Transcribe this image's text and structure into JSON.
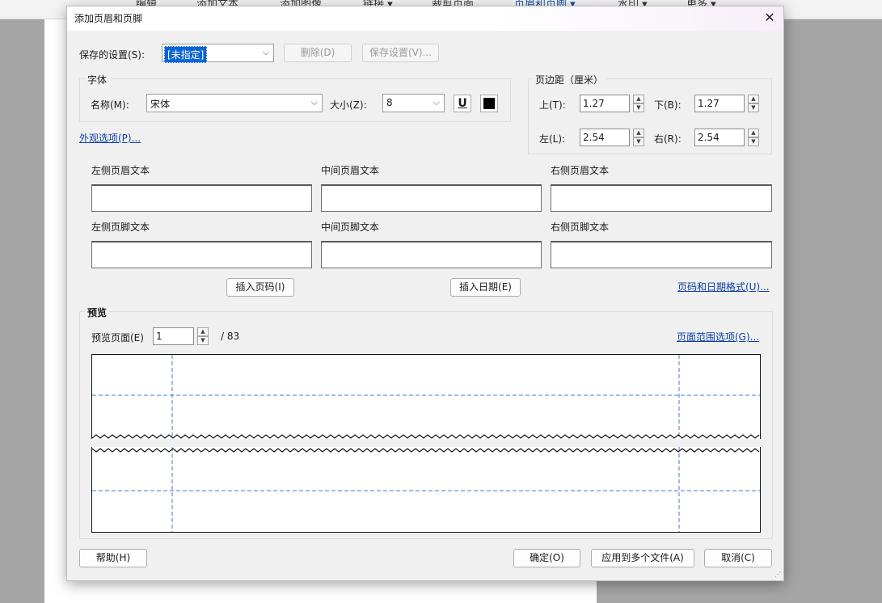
{
  "background_toolbar": {
    "items": [
      "编辑",
      "添加文本",
      "添加图像",
      "链接 ▾",
      "裁剪页面",
      "页眉和页脚 ▾",
      "水印 ▾",
      "更多 ▾"
    ]
  },
  "dialog": {
    "title": "添加页眉和页脚",
    "saved_settings": {
      "label": "保存的设置(S):",
      "value": "[未指定]",
      "delete_label": "删除(D)",
      "save_label": "保存设置(V)..."
    },
    "font": {
      "group_label": "字体",
      "name_label": "名称(M):",
      "name_value": "宋体",
      "size_label": "大小(Z):",
      "size_value": "8",
      "underline_glyph": "U"
    },
    "appearance_link": "外观选项(P)...",
    "margins": {
      "group_label": "页边距（厘米）",
      "top_label": "上(T):",
      "top_value": "1.27",
      "bottom_label": "下(B):",
      "bottom_value": "1.27",
      "left_label": "左(L):",
      "left_value": "2.54",
      "right_label": "右(R):",
      "right_value": "2.54"
    },
    "header_labels": {
      "left": "左侧页眉文本",
      "center": "中间页眉文本",
      "right": "右侧页眉文本"
    },
    "footer_labels": {
      "left": "左侧页脚文本",
      "center": "中间页脚文本",
      "right": "右侧页脚文本"
    },
    "insert_page_number": "插入页码(I)",
    "insert_date": "插入日期(E)",
    "page_date_format_link": "页码和日期格式(U)...",
    "preview": {
      "group_label": "预览",
      "page_label": "预览页面(E)",
      "page_value": "1",
      "page_total": "/ 83",
      "page_range_link": "页面范围选项(G)..."
    },
    "buttons": {
      "help": "帮助(H)",
      "ok": "确定(O)",
      "apply_multiple": "应用到多个文件(A)",
      "cancel": "取消(C)"
    }
  }
}
